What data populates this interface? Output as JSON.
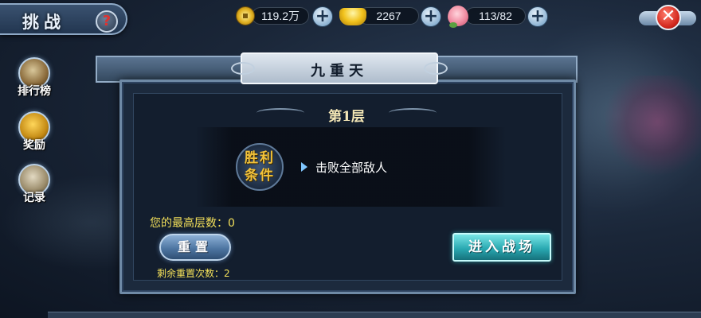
{
  "header": {
    "title": "挑战",
    "help_icon": "question-icon",
    "help_glyph": "?",
    "close_glyph": "✕"
  },
  "resources": [
    {
      "name": "copper-coin-icon",
      "value": "119.2万"
    },
    {
      "name": "gold-ingot-icon",
      "value": "2267"
    },
    {
      "name": "peach-icon",
      "value": "113/82"
    }
  ],
  "plus_glyph": "+",
  "sidebar": {
    "items": [
      {
        "label": "排行榜",
        "icon": "scroll-icon"
      },
      {
        "label": "奖励",
        "icon": "treasure-icon"
      },
      {
        "label": "记录",
        "icon": "quill-icon"
      }
    ]
  },
  "dialog": {
    "title": "九重天",
    "floor": "第1层",
    "condition_badge": "胜利条件",
    "condition_text": "击败全部敌人",
    "best_floor_label": "您的最高层数：0",
    "reset_label": "重置",
    "remaining_resets_label": "剩余重置次数：2",
    "enter_label": "进入战场"
  },
  "colors": {
    "accent_gold": "#f3e05a",
    "close_red": "#d2271d",
    "enter_teal": "#2aa9b2",
    "reset_blue": "#4e76a2"
  }
}
